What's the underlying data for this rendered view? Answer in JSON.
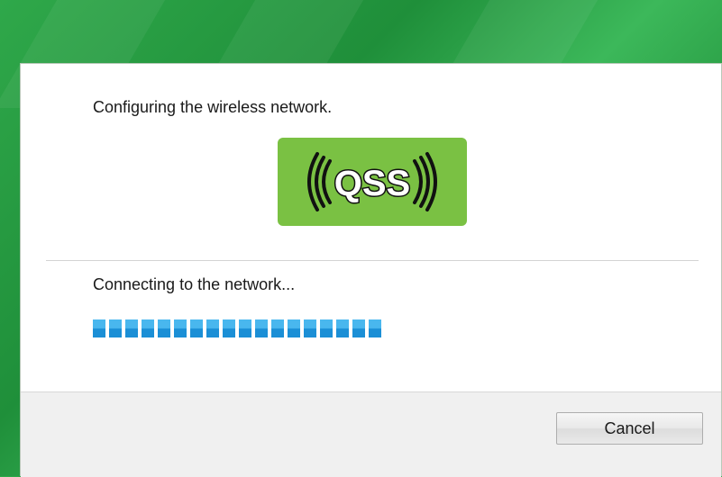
{
  "dialog": {
    "heading": "Configuring the wireless network.",
    "badge": {
      "label": "QSS",
      "icon": "qss-wireless-icon",
      "background_color": "#7ac143"
    },
    "status": "Connecting to the network...",
    "progress": {
      "segments_filled": 18,
      "color": "#1b8fd6"
    },
    "cancel_label": "Cancel"
  }
}
